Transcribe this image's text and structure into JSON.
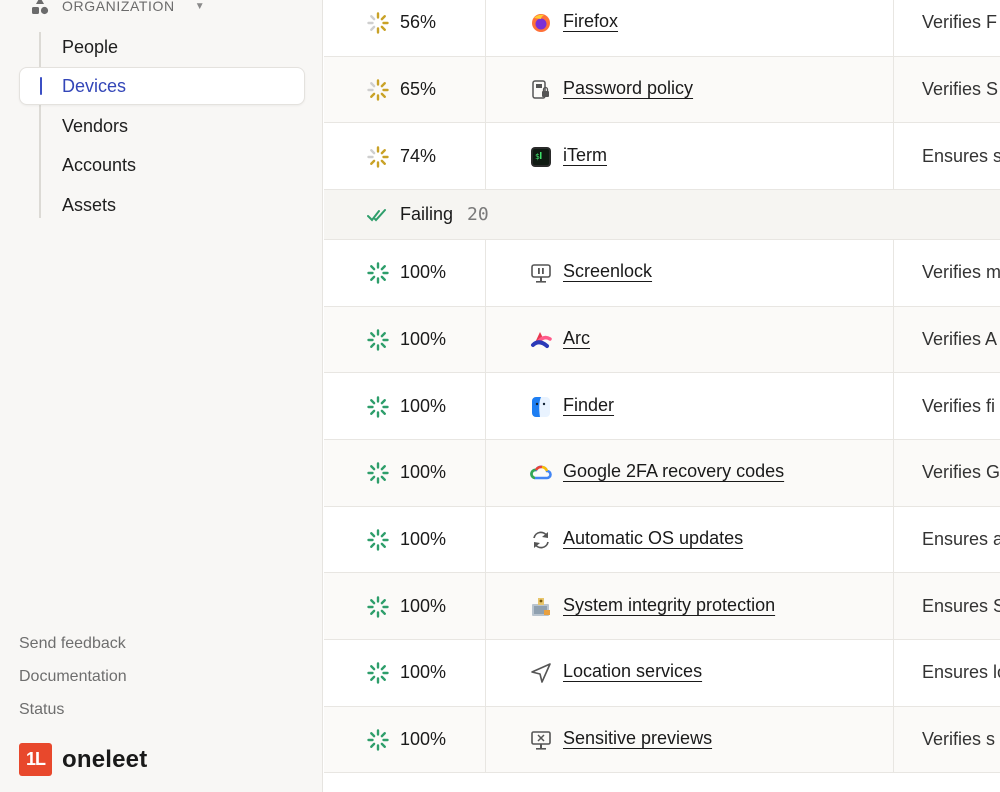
{
  "sidebar": {
    "section_title": "ORGANIZATION",
    "items": [
      {
        "label": "People"
      },
      {
        "label": "Devices",
        "active": true
      },
      {
        "label": "Vendors"
      },
      {
        "label": "Accounts"
      },
      {
        "label": "Assets"
      }
    ],
    "footer": {
      "send_feedback": "Send feedback",
      "documentation": "Documentation",
      "status": "Status"
    },
    "brand": {
      "logo_text": "1L",
      "name": "oneleet"
    }
  },
  "colors": {
    "accent": "#3346b8",
    "spinner_partial": "#c9a227",
    "spinner_full": "#2e9e6b",
    "brand": "#e8482c"
  },
  "rows_top": [
    {
      "pct": "56%",
      "progress": 0.56,
      "icon": "firefox-icon",
      "name": "Firefox",
      "desc": "Verifies F"
    },
    {
      "pct": "65%",
      "progress": 0.65,
      "icon": "password-policy-icon",
      "name": "Password policy",
      "desc": "Verifies S"
    },
    {
      "pct": "74%",
      "progress": 0.74,
      "icon": "iterm-icon",
      "name": "iTerm",
      "desc": "Ensures s"
    }
  ],
  "group": {
    "label": "Failing",
    "count": "20",
    "icon": "double-check-icon"
  },
  "rows_failing": [
    {
      "pct": "100%",
      "progress": 1,
      "icon": "screenlock-icon",
      "name": "Screenlock",
      "desc": "Verifies m"
    },
    {
      "pct": "100%",
      "progress": 1,
      "icon": "arc-icon",
      "name": "Arc",
      "desc": "Verifies A"
    },
    {
      "pct": "100%",
      "progress": 1,
      "icon": "finder-icon",
      "name": "Finder",
      "desc": "Verifies fi"
    },
    {
      "pct": "100%",
      "progress": 1,
      "icon": "google-cloud-icon",
      "name": "Google 2FA recovery codes",
      "desc": "Verifies G"
    },
    {
      "pct": "100%",
      "progress": 1,
      "icon": "refresh-icon",
      "name": "Automatic OS updates",
      "desc": "Ensures a"
    },
    {
      "pct": "100%",
      "progress": 1,
      "icon": "system-integrity-icon",
      "name": "System integrity protection",
      "desc": "Ensures S"
    },
    {
      "pct": "100%",
      "progress": 1,
      "icon": "location-arrow-icon",
      "name": "Location services",
      "desc": "Ensures lo"
    },
    {
      "pct": "100%",
      "progress": 1,
      "icon": "screen-preview-icon",
      "name": "Sensitive previews",
      "desc": "Verifies s"
    }
  ]
}
